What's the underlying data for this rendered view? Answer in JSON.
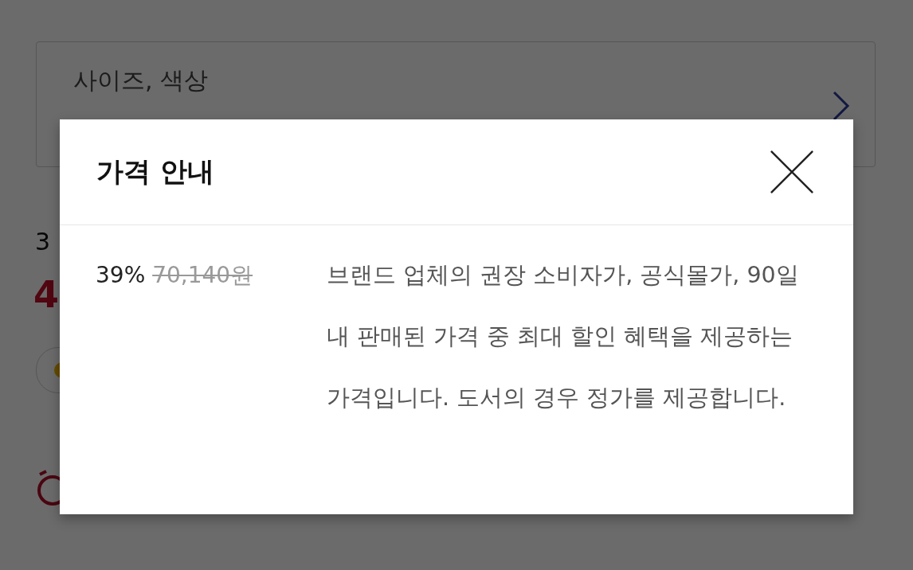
{
  "background": {
    "option_selector": {
      "label": "사이즈, 색상"
    },
    "discount_fragment": "3",
    "price_fragment": "4"
  },
  "dialog": {
    "title": "가격 안내",
    "discount": "39%",
    "original_price": "70,140원",
    "description": "브랜드 업체의 권장 소비자가, 공식몰가, 90일 내 판매된 가격 중 최대 할인 혜택을 제공하는 가격입니다. 도서의 경우 정가를 제공합니다."
  }
}
